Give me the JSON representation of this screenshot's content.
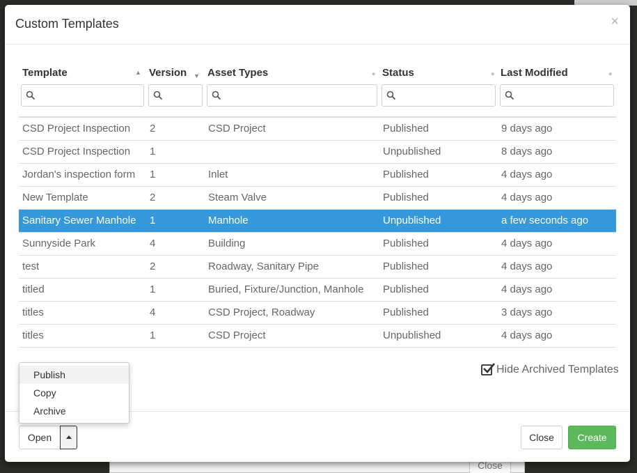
{
  "modal": {
    "title": "Custom Templates",
    "close_glyph": "×"
  },
  "table": {
    "columns": [
      {
        "label": "Template",
        "sort": "asc"
      },
      {
        "label": "Version",
        "sort": "desc"
      },
      {
        "label": "Asset Types",
        "sort": "none"
      },
      {
        "label": "Status",
        "sort": "none"
      },
      {
        "label": "Last Modified",
        "sort": "none"
      }
    ],
    "filters": [
      "",
      "",
      "",
      "",
      ""
    ],
    "rows": [
      {
        "template": "CSD Project Inspection",
        "version": "2",
        "asset_types": "CSD Project",
        "status": "Published",
        "modified": "9 days ago",
        "selected": false
      },
      {
        "template": "CSD Project Inspection",
        "version": "1",
        "asset_types": "",
        "status": "Unpublished",
        "modified": "8 days ago",
        "selected": false
      },
      {
        "template": "Jordan's inspection form",
        "version": "1",
        "asset_types": "Inlet",
        "status": "Published",
        "modified": "4 days ago",
        "selected": false
      },
      {
        "template": "New Template",
        "version": "2",
        "asset_types": "Steam Valve",
        "status": "Published",
        "modified": "4 days ago",
        "selected": false
      },
      {
        "template": "Sanitary Sewer Manhole",
        "version": "1",
        "asset_types": "Manhole",
        "status": "Unpublished",
        "modified": "a few seconds ago",
        "selected": true
      },
      {
        "template": "Sunnyside Park",
        "version": "4",
        "asset_types": "Building",
        "status": "Published",
        "modified": "4 days ago",
        "selected": false
      },
      {
        "template": "test",
        "version": "2",
        "asset_types": "Roadway, Sanitary Pipe",
        "status": "Published",
        "modified": "4 days ago",
        "selected": false
      },
      {
        "template": "titled",
        "version": "1",
        "asset_types": "Buried, Fixture/Junction, Manhole",
        "status": "Published",
        "modified": "4 days ago",
        "selected": false
      },
      {
        "template": "titles",
        "version": "4",
        "asset_types": "CSD Project, Roadway",
        "status": "Published",
        "modified": "3 days ago",
        "selected": false
      },
      {
        "template": "titles",
        "version": "1",
        "asset_types": "CSD Project",
        "status": "Unpublished",
        "modified": "4 days ago",
        "selected": false
      }
    ]
  },
  "hide_archived": {
    "label": "Hide Archived Templates",
    "checked": true
  },
  "dropdown": {
    "items": [
      "Publish",
      "Copy",
      "Archive"
    ]
  },
  "footer": {
    "open_label": "Open",
    "close_label": "Close",
    "create_label": "Create"
  },
  "background": {
    "close_label": "Close"
  },
  "colors": {
    "selected_row": "#3498db",
    "create_button": "#5cb85c"
  }
}
